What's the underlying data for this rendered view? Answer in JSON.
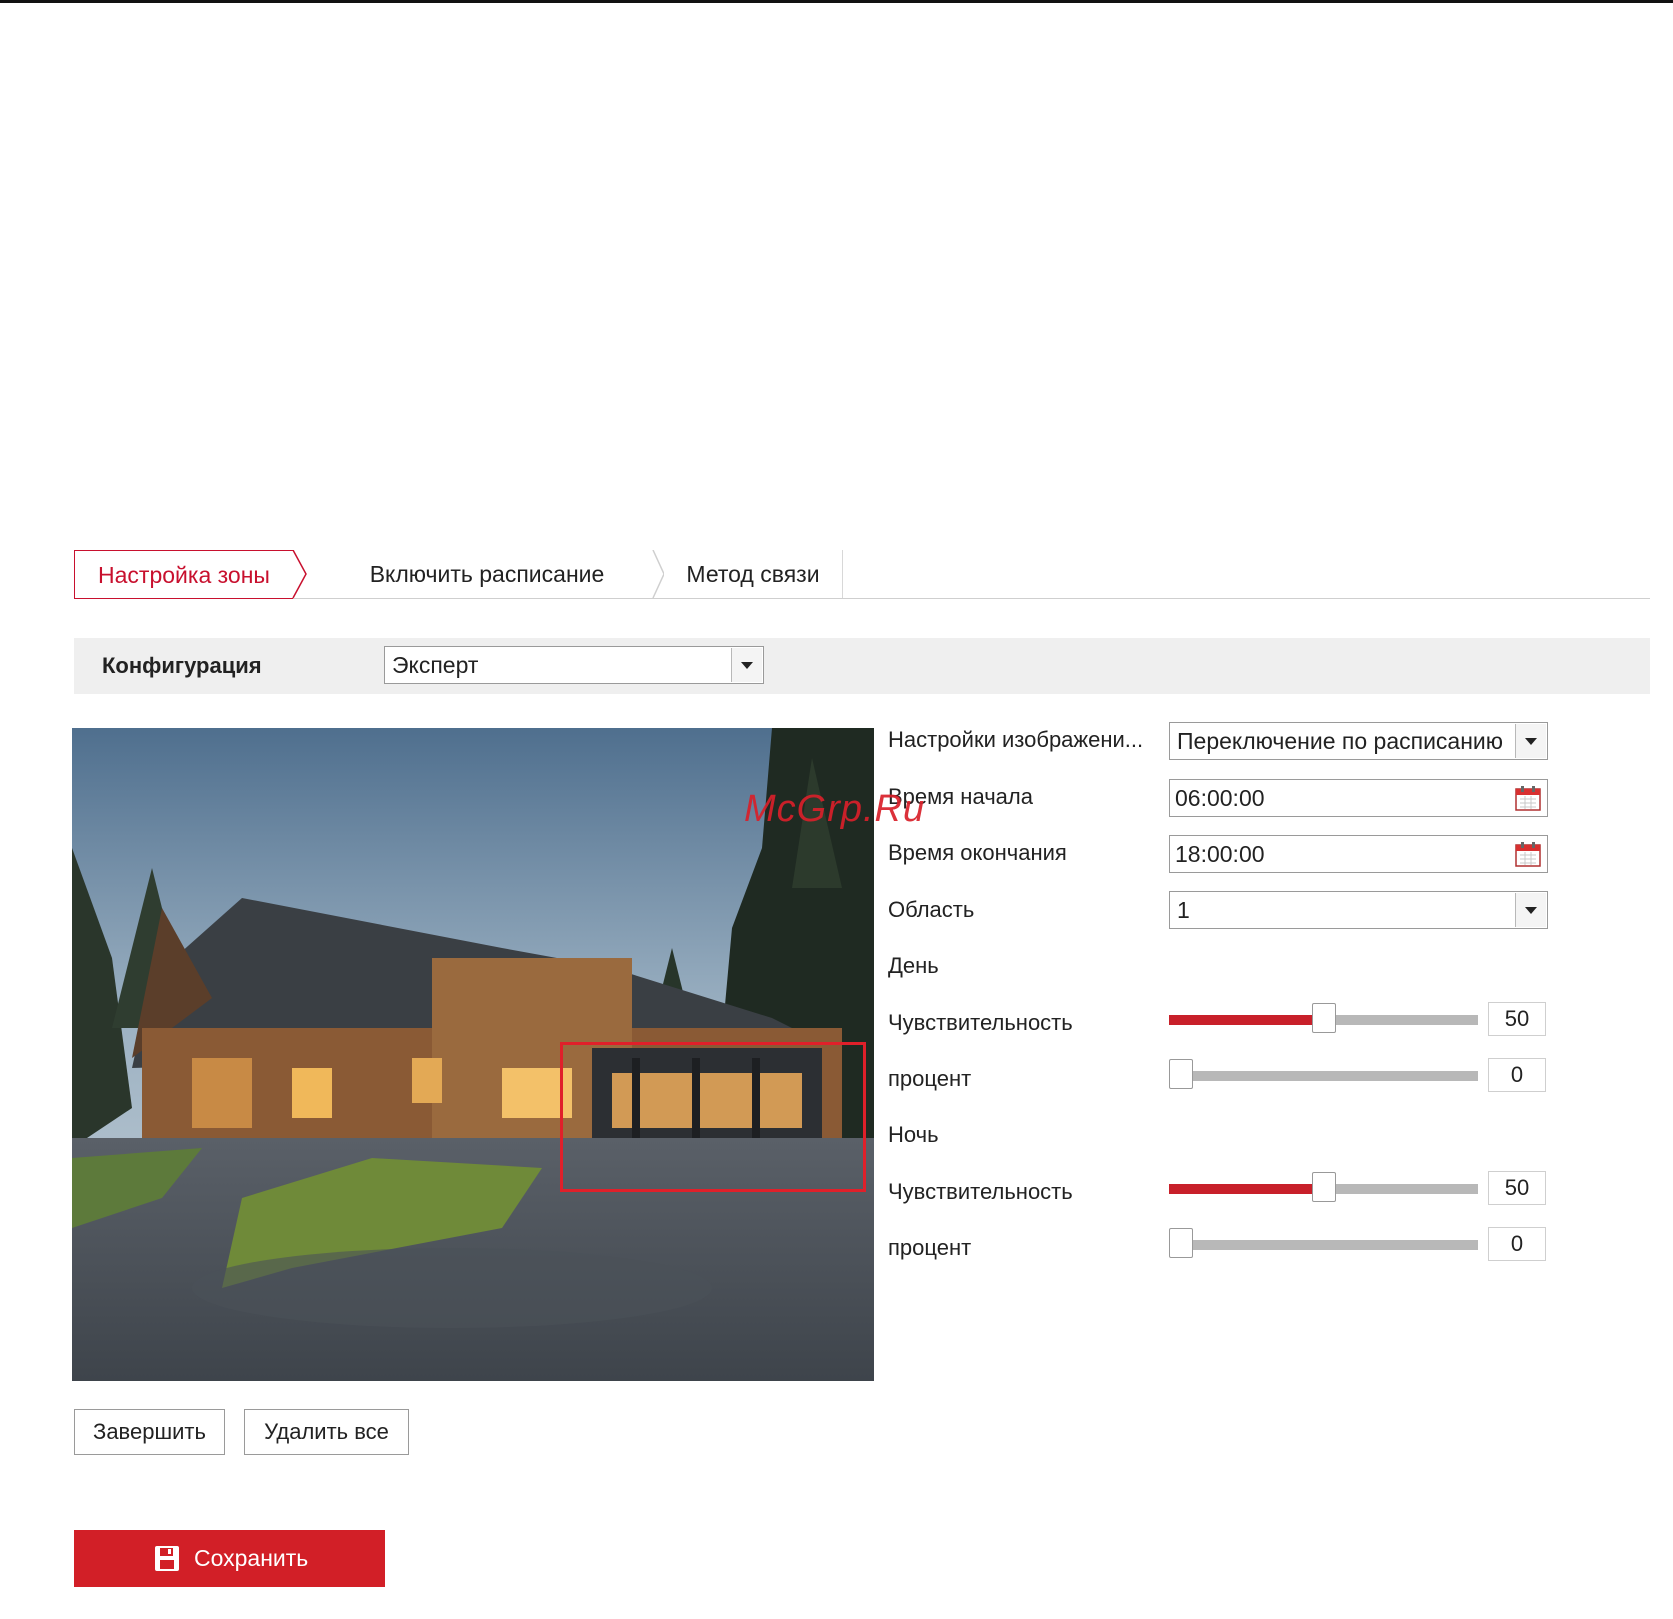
{
  "tabs": [
    {
      "label": "Настройка зоны",
      "active": true
    },
    {
      "label": "Включить расписание",
      "active": false
    },
    {
      "label": "Метод связи",
      "active": false
    }
  ],
  "config": {
    "label": "Конфигурация",
    "value": "Эксперт"
  },
  "settings": {
    "image_settings": {
      "label": "Настройки изображени...",
      "value": "Переключение по расписанию"
    },
    "start_time": {
      "label": "Время начала",
      "value": "06:00:00"
    },
    "end_time": {
      "label": "Время окончания",
      "value": "18:00:00"
    },
    "area": {
      "label": "Область",
      "value": "1"
    },
    "day": {
      "heading": "День",
      "sensitivity": {
        "label": "Чувствительность",
        "value": 50,
        "display": "50"
      },
      "percent": {
        "label": "процент",
        "value": 0,
        "display": "0"
      }
    },
    "night": {
      "heading": "Ночь",
      "sensitivity": {
        "label": "Чувствительность",
        "value": 50,
        "display": "50"
      },
      "percent": {
        "label": "процент",
        "value": 0,
        "display": "0"
      }
    }
  },
  "buttons": {
    "finish": "Завершить",
    "delete_all": "Удалить все",
    "save": "Сохранить"
  },
  "watermark": "McGrp.Ru",
  "colors": {
    "accent": "#c8102e",
    "save_bg": "#d21f27",
    "slider_fill": "#c8202a",
    "roi": "#e0202a"
  },
  "icons": {
    "calendar": "calendar-icon",
    "save": "floppy-disk-icon",
    "dropdown": "chevron-down-icon"
  }
}
